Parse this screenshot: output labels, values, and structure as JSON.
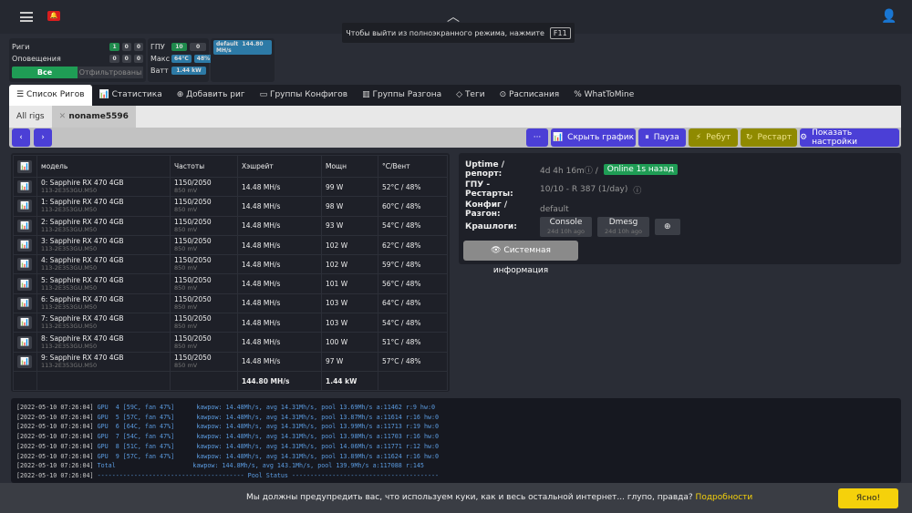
{
  "fullscreen_notice": {
    "text": "Чтобы выйти из полноэкранного режима, нажмите",
    "key": "F11"
  },
  "stats": {
    "rigs_label": "Риги",
    "rigs": [
      "1",
      "0",
      "0"
    ],
    "alerts_label": "Оповещения",
    "alerts": [
      "0",
      "0",
      "0"
    ],
    "all": "Все",
    "filtered": "Отфильтрованы",
    "gpu_label": "ГПУ",
    "gpu": [
      "10",
      "0"
    ],
    "max_label": "Макс",
    "max": [
      "64°C",
      "48%"
    ],
    "watt_label": "Ватт",
    "watt": "1.44 kW",
    "algo": "default",
    "algo_rate": "144.80 MH/s"
  },
  "tabs": [
    "Список Ригов",
    "Статистика",
    "Добавить риг",
    "Группы Конфигов",
    "Группы Разгона",
    "Теги",
    "Расписания",
    "WhatToMine"
  ],
  "subtabs": {
    "all": "All rigs",
    "rig": "noname5596"
  },
  "buttons": {
    "more": "···",
    "hide_chart": "Скрыть график",
    "pause": "Пауза",
    "reboot": "Ребут",
    "restart": "Рестарт",
    "settings": "Показать настройки"
  },
  "table": {
    "headers": [
      "модель",
      "Частоты",
      "Хэшрейт",
      "Мощн",
      "°C/Вент"
    ],
    "rows": [
      {
        "model": "0: Sapphire RX 470 4GB",
        "bios": "113-2E353GU.M50",
        "clock": "1150/2050",
        "volt": "850 mV",
        "hash": "14.48 MH/s",
        "power": "99 W",
        "temp": "52°C / 48%"
      },
      {
        "model": "1: Sapphire RX 470 4GB",
        "bios": "113-2E353GU.M50",
        "clock": "1150/2050",
        "volt": "850 mV",
        "hash": "14.48 MH/s",
        "power": "98 W",
        "temp": "60°C / 48%"
      },
      {
        "model": "2: Sapphire RX 470 4GB",
        "bios": "113-2E353GU.M50",
        "clock": "1150/2050",
        "volt": "850 mV",
        "hash": "14.48 MH/s",
        "power": "93 W",
        "temp": "54°C / 48%"
      },
      {
        "model": "3: Sapphire RX 470 4GB",
        "bios": "113-2E353GU.M50",
        "clock": "1150/2050",
        "volt": "850 mV",
        "hash": "14.48 MH/s",
        "power": "102 W",
        "temp": "62°C / 48%"
      },
      {
        "model": "4: Sapphire RX 470 4GB",
        "bios": "113-2E353GU.M50",
        "clock": "1150/2050",
        "volt": "850 mV",
        "hash": "14.48 MH/s",
        "power": "102 W",
        "temp": "59°C / 48%"
      },
      {
        "model": "5: Sapphire RX 470 4GB",
        "bios": "113-2E353GU.M50",
        "clock": "1150/2050",
        "volt": "850 mV",
        "hash": "14.48 MH/s",
        "power": "101 W",
        "temp": "56°C / 48%"
      },
      {
        "model": "6: Sapphire RX 470 4GB",
        "bios": "113-2E353GU.M50",
        "clock": "1150/2050",
        "volt": "850 mV",
        "hash": "14.48 MH/s",
        "power": "103 W",
        "temp": "64°C / 48%"
      },
      {
        "model": "7: Sapphire RX 470 4GB",
        "bios": "113-2E353GU.M50",
        "clock": "1150/2050",
        "volt": "850 mV",
        "hash": "14.48 MH/s",
        "power": "103 W",
        "temp": "54°C / 48%"
      },
      {
        "model": "8: Sapphire RX 470 4GB",
        "bios": "113-2E353GU.M50",
        "clock": "1150/2050",
        "volt": "850 mV",
        "hash": "14.48 MH/s",
        "power": "100 W",
        "temp": "51°C / 48%"
      },
      {
        "model": "9: Sapphire RX 470 4GB",
        "bios": "113-2E353GU.M50",
        "clock": "1150/2050",
        "volt": "850 mV",
        "hash": "14.48 MH/s",
        "power": "97 W",
        "temp": "57°C / 48%"
      }
    ],
    "total_hash": "144.80 MH/s",
    "total_power": "1.44 kW"
  },
  "info": {
    "uptime_label": "Uptime / репорт:",
    "uptime": "4d 4h 16m",
    "online": "Online 1s назад",
    "gpu_label": "ГПУ - Рестарты:",
    "gpu": "10/10 - R 387 (1/day)",
    "config_label": "Конфиг / Разгон:",
    "config": "default",
    "crash_label": "Крашлоги:",
    "console": "Console",
    "console_ago": "24d 10h ago",
    "dmesg": "Dmesg",
    "dmesg_ago": "24d 10h ago",
    "sysinfo": "Системная информация"
  },
  "log": [
    {
      "ts": "[2022-05-10 07:26:04]",
      "src": "GPU  4 [59C, fan 47%]",
      "msg": "kawpow: 14.48Mh/s, avg 14.31Mh/s, pool 13.69Mh/s a:11462 r:9 hw:0"
    },
    {
      "ts": "[2022-05-10 07:26:04]",
      "src": "GPU  5 [57C, fan 47%]",
      "msg": "kawpow: 14.48Mh/s, avg 14.31Mh/s, pool 13.87Mh/s a:11614 r:16 hw:0"
    },
    {
      "ts": "[2022-05-10 07:26:04]",
      "src": "GPU  6 [64C, fan 47%]",
      "msg": "kawpow: 14.48Mh/s, avg 14.31Mh/s, pool 13.99Mh/s a:11713 r:19 hw:0"
    },
    {
      "ts": "[2022-05-10 07:26:04]",
      "src": "GPU  7 [54C, fan 47%]",
      "msg": "kawpow: 14.48Mh/s, avg 14.31Mh/s, pool 13.98Mh/s a:11703 r:16 hw:0"
    },
    {
      "ts": "[2022-05-10 07:26:04]",
      "src": "GPU  8 [51C, fan 47%]",
      "msg": "kawpow: 14.48Mh/s, avg 14.31Mh/s, pool 14.06Mh/s a:11771 r:12 hw:0"
    },
    {
      "ts": "[2022-05-10 07:26:04]",
      "src": "GPU  9 [57C, fan 47%]",
      "msg": "kawpow: 14.48Mh/s, avg 14.31Mh/s, pool 13.89Mh/s a:11624 r:16 hw:0"
    },
    {
      "ts": "[2022-05-10 07:26:04]",
      "src": "Total               ",
      "msg": "kawpow: 144.8Mh/s, avg 143.1Mh/s, pool 139.9Mh/s a:117088 r:145"
    },
    {
      "ts": "[2022-05-10 07:26:04]",
      "src": "",
      "msg": "---------------------------------------- Pool Status ----------------------------------------"
    }
  ],
  "cookie": {
    "text": "Мы должны предупредить вас, что используем куки, как и весь остальной интернет... глупо, правда?",
    "link": "Подробности",
    "ok": "Ясно!"
  }
}
